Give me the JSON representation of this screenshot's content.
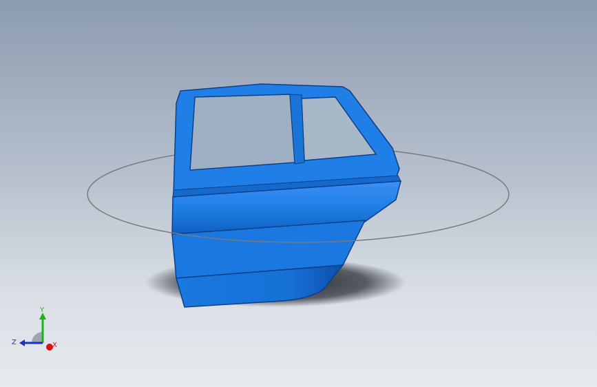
{
  "model": {
    "name": "",
    "body_color": "#1f7fe6",
    "shadow_color": "#2d3138",
    "ring_color": "#7a7a7a"
  },
  "triad": {
    "x_label": "X",
    "y_label": "Y",
    "z_label": "Z",
    "x_color": "#e01010",
    "y_color": "#19b219",
    "z_color": "#1c2fc9"
  }
}
